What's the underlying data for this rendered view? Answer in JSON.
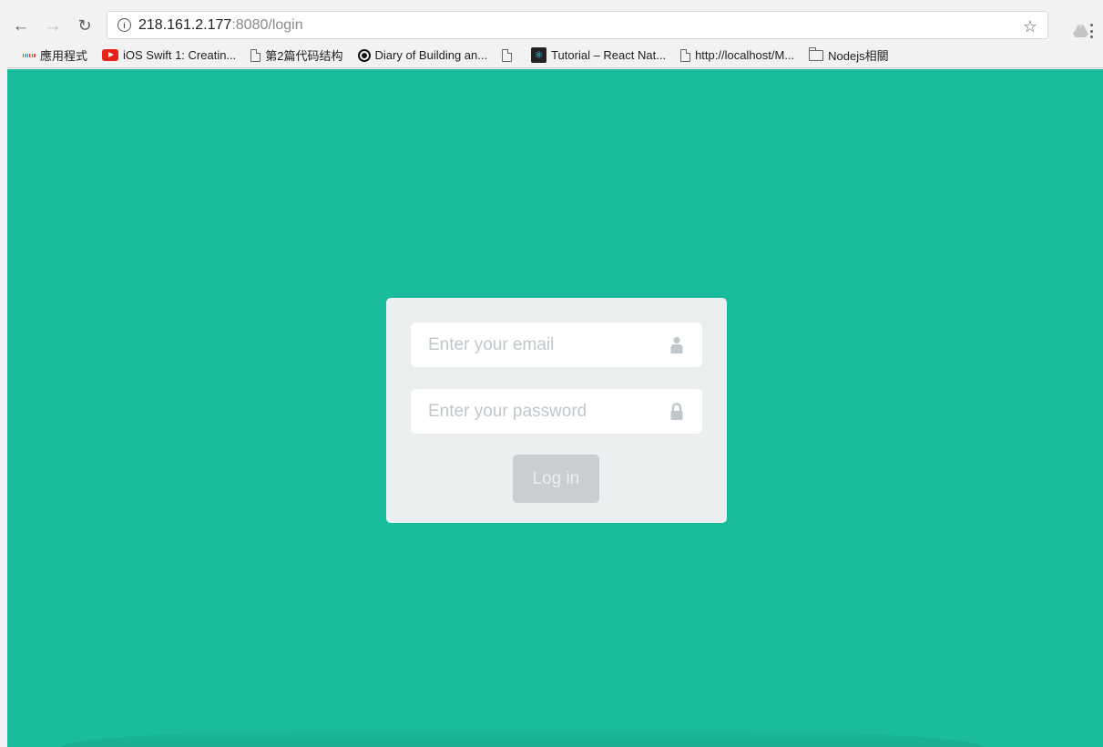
{
  "browser": {
    "back_icon": "arrow-left-icon",
    "forward_icon": "arrow-right-icon",
    "reload_icon": "reload-icon",
    "address": {
      "host": "218.161.2.177",
      "rest": ":8080/login"
    },
    "star_icon": "star-icon",
    "menu_icon": "kebab-menu-icon"
  },
  "bookmarks": [
    {
      "label": "應用程式",
      "icon": "apps-grid-icon"
    },
    {
      "label": "iOS Swift 1: Creatin...",
      "icon": "youtube-icon"
    },
    {
      "label": "第2篇代码结构",
      "icon": "page-icon"
    },
    {
      "label": "Diary of Building an...",
      "icon": "target-icon"
    },
    {
      "label": "",
      "icon": "page-icon"
    },
    {
      "label": "Tutorial – React Nat...",
      "icon": "react-icon"
    },
    {
      "label": "http://localhost/M...",
      "icon": "page-icon"
    },
    {
      "label": "Nodejs相關",
      "icon": "folder-icon"
    }
  ],
  "login": {
    "email_placeholder": "Enter your email",
    "email_value": "",
    "password_placeholder": "Enter your password",
    "password_value": "",
    "button_label": "Log in"
  },
  "colors": {
    "page_background": "#1abc9c",
    "card_background": "#eceff0",
    "button_background": "#c8ced1",
    "placeholder_text": "#bfc7cb"
  }
}
